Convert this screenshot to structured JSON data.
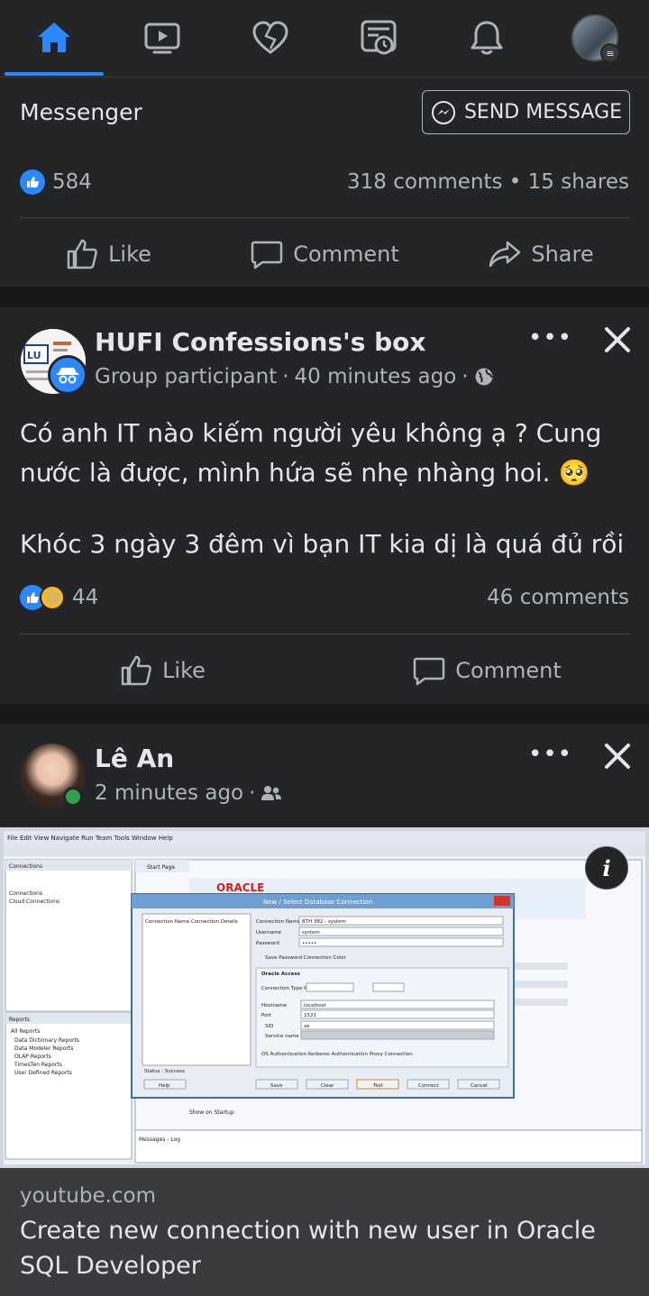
{
  "nav": {
    "items": [
      {
        "icon": "home-icon",
        "active": true
      },
      {
        "icon": "watch-icon"
      },
      {
        "icon": "dating-heart-icon"
      },
      {
        "icon": "memories-icon"
      },
      {
        "icon": "notifications-bell-icon"
      },
      {
        "icon": "profile-avatar"
      }
    ],
    "accent": "#2d88ff"
  },
  "card1": {
    "messenger_label": "Messenger",
    "send_message_label": "SEND MESSAGE",
    "likes_count": "584",
    "comments_shares": "318 comments • 15 shares",
    "actions": {
      "like": "Like",
      "comment": "Comment",
      "share": "Share"
    }
  },
  "post2": {
    "author": "HUFI Confessions's box",
    "role": "Group participant",
    "time": "40 minutes ago",
    "privacy_icon": "globe-icon",
    "text_line1": "Có anh IT nào kiếm người yêu không ạ ? Cung nước là được, mình hứa sẽ nhẹ nhàng hoi. 🥺",
    "text_line2": "Khóc 3 ngày 3 đêm vì bạn IT kia dị là quá đủ rồi",
    "reactions_count": "44",
    "comments": "46 comments",
    "actions": {
      "like": "Like",
      "comment": "Comment"
    }
  },
  "post3": {
    "author": "Lê An",
    "time": "2 minutes ago",
    "audience_icon": "friends-icon",
    "online": true,
    "preview": {
      "window_title": "New / Select Database Connection",
      "brand": "ORACLE",
      "connection_name": "BTH 382 - system",
      "username": "system",
      "password": "•••••",
      "hostname": "localhost",
      "port": "1521",
      "sid": "xe",
      "status": "Status : Success",
      "buttons": [
        "Help",
        "Save",
        "Clear",
        "Test",
        "Connect",
        "Cancel"
      ]
    },
    "link_domain": "youtube.com",
    "link_title": "Create new connection with new user in Oracle SQL Developer"
  }
}
